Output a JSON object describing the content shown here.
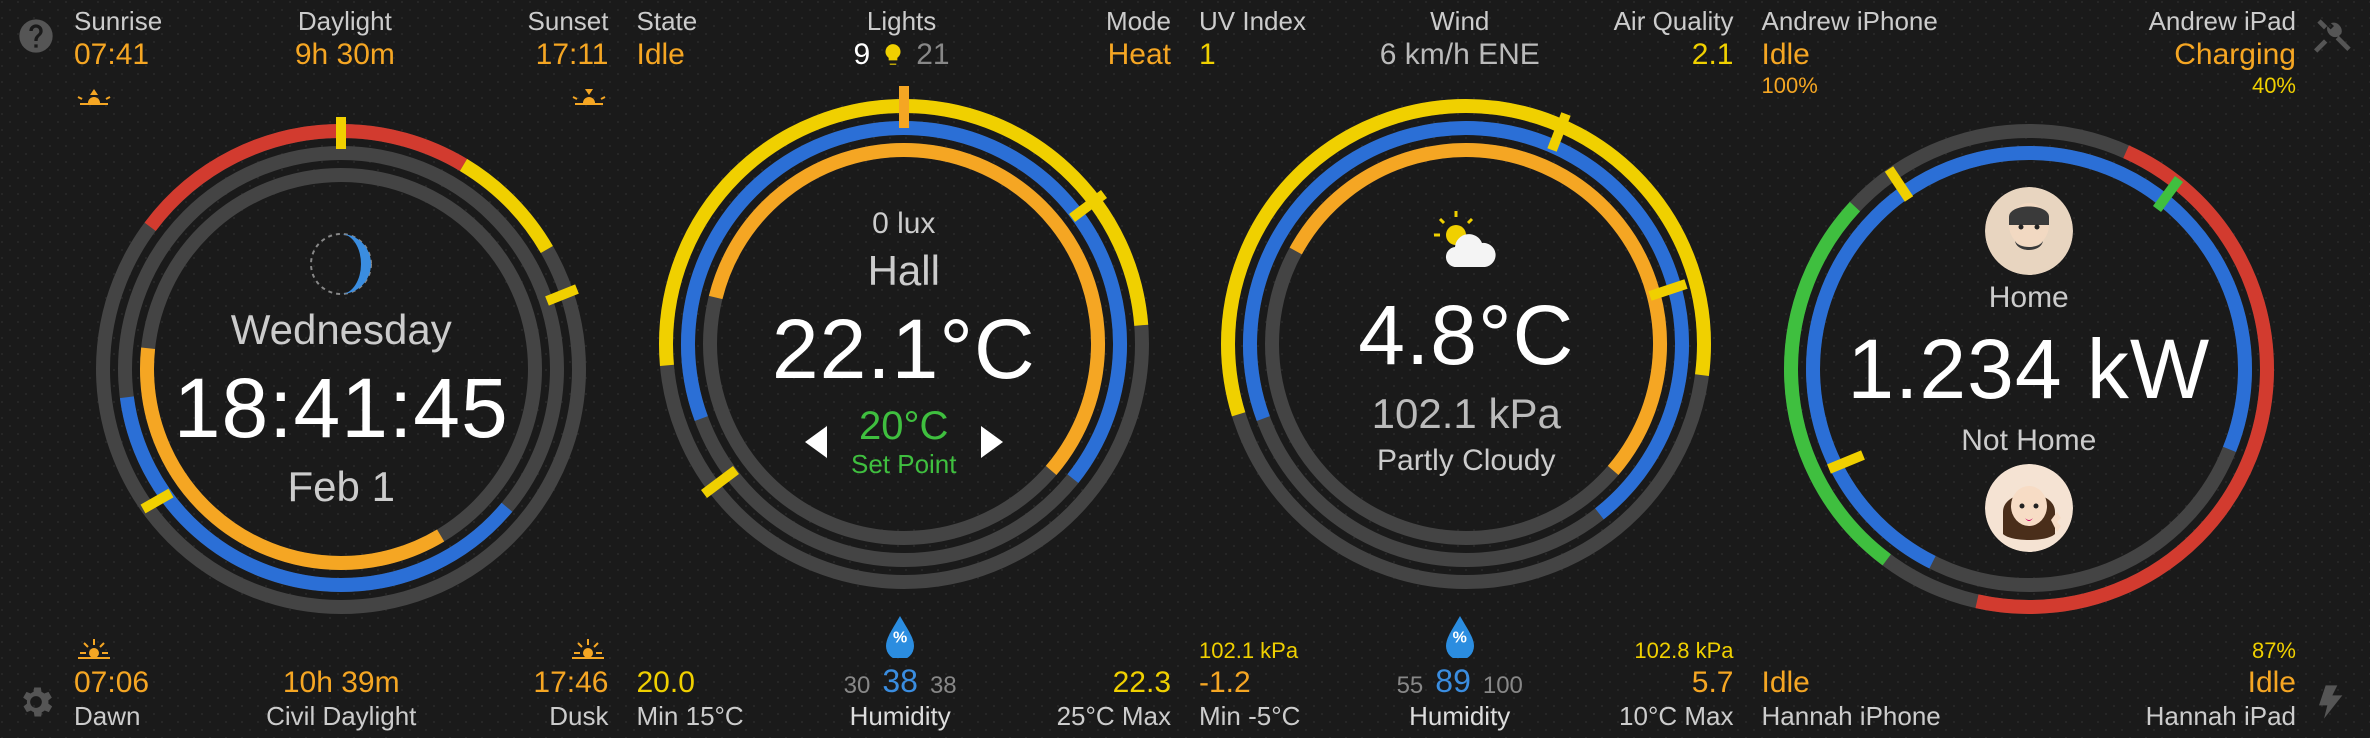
{
  "corners": {
    "help": "?",
    "tools": "tools",
    "settings": "gear",
    "power": "bolt"
  },
  "panel1": {
    "top": {
      "sunrise_label": "Sunrise",
      "sunrise_value": "07:41",
      "daylight_label": "Daylight",
      "daylight_value": "9h 30m",
      "sunset_label": "Sunset",
      "sunset_value": "17:11"
    },
    "center": {
      "weekday": "Wednesday",
      "time": "18:41:45",
      "date": "Feb 1"
    },
    "bottom": {
      "dawn_label": "Dawn",
      "dawn_value": "07:06",
      "civil_label": "Civil Daylight",
      "civil_value": "10h 39m",
      "dusk_label": "Dusk",
      "dusk_value": "17:46"
    }
  },
  "panel2": {
    "top": {
      "state_label": "State",
      "state_value": "Idle",
      "lights_label": "Lights",
      "lights_on": "9",
      "lights_total": "21",
      "mode_label": "Mode",
      "mode_value": "Heat"
    },
    "center": {
      "lux": "0 lux",
      "room": "Hall",
      "temp": "22.1°C",
      "setpoint": "20°C",
      "setpoint_label": "Set Point"
    },
    "bottom": {
      "min_value": "20.0",
      "min_label": "Min 15°C",
      "hum_lo": "30",
      "hum_val": "38",
      "hum_hi": "38",
      "hum_label": "Humidity",
      "max_value": "22.3",
      "max_label": "25°C Max"
    }
  },
  "panel3": {
    "top": {
      "uv_label": "UV Index",
      "uv_value": "1",
      "wind_label": "Wind",
      "wind_value": "6 km/h ENE",
      "aq_label": "Air Quality",
      "aq_value": "2.1"
    },
    "center": {
      "temp": "4.8°C",
      "pressure": "102.1 kPa",
      "cond": "Partly Cloudy"
    },
    "bottom": {
      "press_lo": "102.1 kPa",
      "min_value": "-1.2",
      "min_label": "Min -5°C",
      "hum_lo": "55",
      "hum_val": "89",
      "hum_hi": "100",
      "hum_label": "Humidity",
      "press_hi": "102.8 kPa",
      "max_value": "5.7",
      "max_label": "10°C Max"
    }
  },
  "panel4": {
    "top": {
      "a_iphone_label": "Andrew iPhone",
      "a_iphone_value": "Idle",
      "a_iphone_pct": "100%",
      "a_ipad_label": "Andrew iPad",
      "a_ipad_value": "Charging",
      "a_ipad_pct": "40%"
    },
    "center": {
      "home_label": "Home",
      "power": "1.234 kW",
      "nothome_label": "Not Home"
    },
    "bottom": {
      "h_iphone_label": "Hannah iPhone",
      "h_iphone_value": "Idle",
      "h_iphone_pct": "87%",
      "h_ipad_label": "Hannah iPad",
      "h_ipad_value": "Idle"
    }
  },
  "colors": {
    "orange": "#f5a623",
    "yellow": "#f0d000",
    "red": "#d23b2f",
    "blue": "#2b6fd6",
    "green": "#3fbf3f",
    "track": "#444"
  }
}
